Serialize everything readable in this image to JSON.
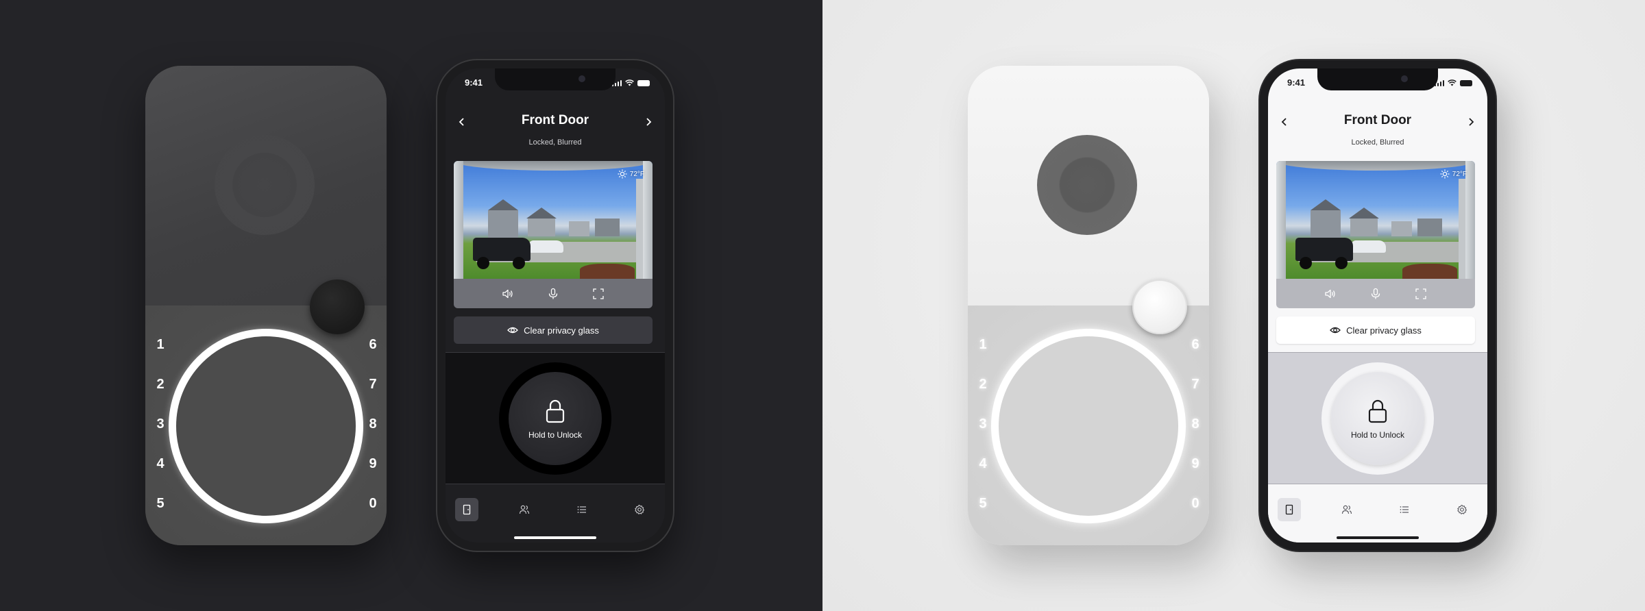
{
  "keypad": {
    "left_keys": [
      "1",
      "2",
      "3",
      "4",
      "5"
    ],
    "right_keys": [
      "6",
      "7",
      "8",
      "9",
      "0"
    ]
  },
  "phone": {
    "status_time": "9:41",
    "title": "Front Door",
    "subtitle": "Locked, Blurred",
    "weather_temp": "72°F",
    "privacy_button_label": "Clear privacy glass",
    "unlock_label": "Hold to Unlock",
    "camera_controls": [
      "speaker-icon",
      "microphone-icon",
      "fullscreen-icon"
    ],
    "tabs": [
      "door-icon",
      "people-icon",
      "list-icon",
      "gear-icon"
    ],
    "active_tab": "door-icon"
  },
  "themes": {
    "dark": {
      "background": "#242428",
      "screen": "#1f1f22",
      "text": "#ffffff"
    },
    "light": {
      "background": "#e9e9e9",
      "screen": "#f7f7f8",
      "text": "#1c1c1e"
    }
  }
}
